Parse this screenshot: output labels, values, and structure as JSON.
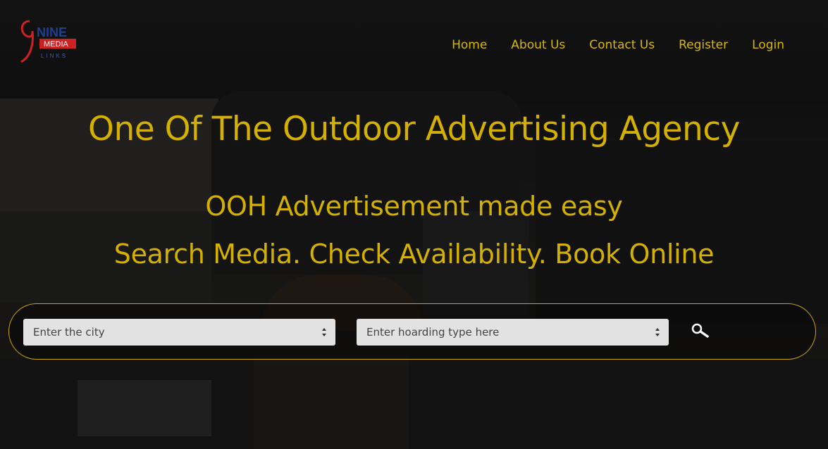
{
  "logo": {
    "alt_text": "NINE MEDIA LINKS",
    "word_top": "NINE",
    "word_mid": "MEDIA",
    "word_bottom": "LINKS"
  },
  "nav": {
    "items": [
      {
        "label": "Home"
      },
      {
        "label": "About Us"
      },
      {
        "label": "Contact Us"
      },
      {
        "label": "Register"
      },
      {
        "label": "Login"
      }
    ]
  },
  "hero": {
    "title": "One Of The Outdoor Advertising Agency",
    "subtitle": "OOH Advertisement made easy",
    "tagline": "Search Media. Check Availability. Book Online"
  },
  "search": {
    "city_placeholder": "Enter the city",
    "hoarding_placeholder": "Enter hoarding type here",
    "icon": "magnifier-icon"
  },
  "colors": {
    "accent": "#d4b000",
    "logo_red": "#cc2222",
    "logo_blue": "#1f3f8f",
    "select_bg": "#e2e2e2"
  }
}
